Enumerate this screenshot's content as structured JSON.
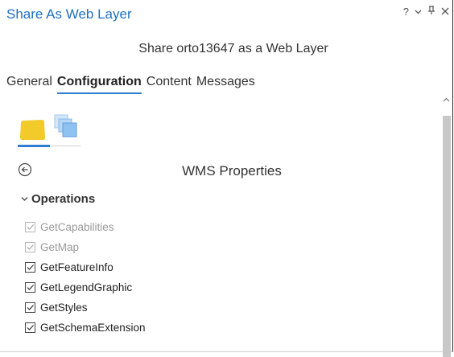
{
  "window": {
    "title": "Share As Web Layer",
    "controls": {
      "help": "?",
      "dropdown": "▾",
      "pin": "ɹ",
      "close": "×"
    }
  },
  "subtitle": "Share orto13647 as a Web Layer",
  "tabs": [
    {
      "label": "General",
      "active": false
    },
    {
      "label": "Configuration",
      "active": true
    },
    {
      "label": "Content",
      "active": false
    },
    {
      "label": "Messages",
      "active": false
    }
  ],
  "subtabs": [
    {
      "icon": "folder-icon",
      "active": true
    },
    {
      "icon": "layers-icon",
      "active": false
    }
  ],
  "section": {
    "title": "WMS Properties"
  },
  "operations": {
    "header": "Operations",
    "items": [
      {
        "label": "GetCapabilities",
        "checked": true,
        "enabled": false
      },
      {
        "label": "GetMap",
        "checked": true,
        "enabled": false
      },
      {
        "label": "GetFeatureInfo",
        "checked": true,
        "enabled": true
      },
      {
        "label": "GetLegendGraphic",
        "checked": true,
        "enabled": true
      },
      {
        "label": "GetStyles",
        "checked": true,
        "enabled": true
      },
      {
        "label": "GetSchemaExtension",
        "checked": true,
        "enabled": true
      }
    ]
  },
  "colors": {
    "accent": "#2f7fd0",
    "title": "#1f6fc0",
    "folder": "#f2cb2a",
    "layers": "#7fb7ea"
  }
}
